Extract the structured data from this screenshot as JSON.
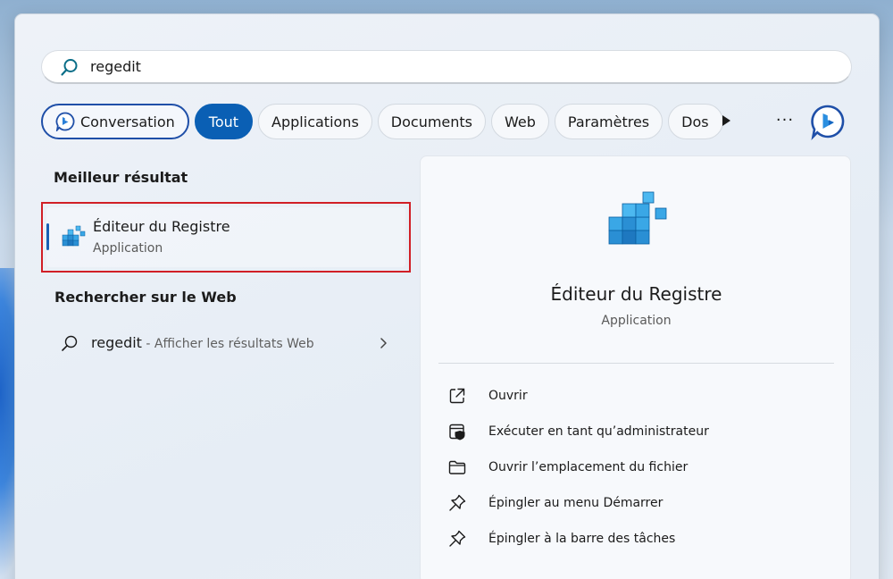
{
  "search": {
    "value": "regedit",
    "placeholder": ""
  },
  "filters": {
    "conversation": "Conversation",
    "items": [
      "Tout",
      "Applications",
      "Documents",
      "Web",
      "Paramètres",
      "Dos"
    ],
    "active": "Tout",
    "more_label": "···"
  },
  "left": {
    "best_header": "Meilleur résultat",
    "best": {
      "title": "Éditeur du Registre",
      "subtitle": "Application"
    },
    "web_header": "Rechercher sur le Web",
    "web": {
      "query": "regedit",
      "hint": " - Afficher les résultats Web"
    }
  },
  "detail": {
    "title": "Éditeur du Registre",
    "subtitle": "Application",
    "actions": [
      {
        "label": "Ouvrir",
        "icon": "open-external-icon"
      },
      {
        "label": "Exécuter en tant qu’administrateur",
        "icon": "shield-admin-icon"
      },
      {
        "label": "Ouvrir l’emplacement du fichier",
        "icon": "folder-icon"
      },
      {
        "label": "Épingler au menu Démarrer",
        "icon": "pin-icon"
      },
      {
        "label": "Épingler à la barre des tâches",
        "icon": "pin-icon"
      }
    ]
  },
  "colors": {
    "accent": "#0a5fb4",
    "highlight_border": "#d11f26",
    "conversation_border": "#1f4fa8"
  }
}
